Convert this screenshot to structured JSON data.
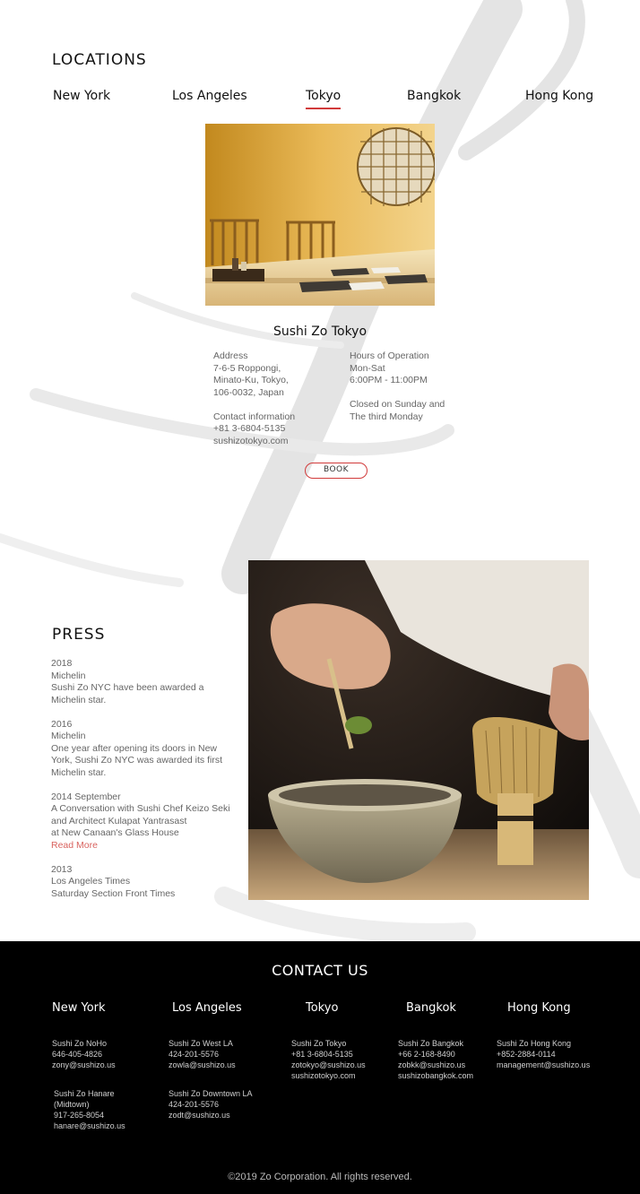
{
  "colors": {
    "accent": "#d13a3a",
    "link": "#d9635f",
    "footer_bg": "#000000"
  },
  "locations": {
    "title": "LOCATIONS",
    "tabs": [
      "New York",
      "Los Angeles",
      "Tokyo",
      "Bangkok",
      "Hong Kong"
    ],
    "active_tab": "Tokyo",
    "selected": {
      "name": "Sushi Zo Tokyo",
      "address_label": "Address",
      "address_lines": [
        "7-6-5 Roppongi,",
        "Minato-Ku, Tokyo,",
        "106-0032, Japan"
      ],
      "contact_label": "Contact information",
      "contact_lines": [
        "+81 3-6804-5135",
        "sushizotokyo.com"
      ],
      "hours_label": "Hours of Operation",
      "hours_lines": [
        "Mon-Sat",
        "6:00PM - 11:00PM"
      ],
      "closed_lines": [
        "Closed on Sunday and",
        "The third Monday"
      ],
      "book_label": "BOOK"
    }
  },
  "press": {
    "title": "PRESS",
    "entries": [
      {
        "lines": [
          "2018",
          "Michelin",
          "Sushi Zo NYC have been awarded a",
          "Michelin star."
        ]
      },
      {
        "lines": [
          "2016",
          "Michelin",
          "One year after opening its doors in New",
          "York, Sushi Zo NYC was awarded its first",
          "Michelin star."
        ]
      },
      {
        "lines": [
          "2014 September",
          "A Conversation with Sushi Chef Keizo Seki",
          "and Architect Kulapat Yantrasast",
          "at New Canaan's Glass House"
        ],
        "link": "Read More"
      },
      {
        "lines": [
          "2013",
          "Los Angeles Times",
          "Saturday Section Front Times"
        ]
      }
    ]
  },
  "footer": {
    "title": "CONTACT US",
    "cities": [
      "New York",
      "Los Angeles",
      "Tokyo",
      "Bangkok",
      "Hong Kong"
    ],
    "blocks": [
      [
        "Sushi Zo NoHo",
        "646-405-4826",
        "zony@sushizo.us"
      ],
      [
        "Sushi Zo Hanare",
        "(Midtown)",
        "917-265-8054",
        "hanare@sushizo.us"
      ],
      [
        "Sushi Zo West LA",
        "424-201-5576",
        "zowla@sushizo.us"
      ],
      [
        "Sushi Zo Downtown LA",
        "424-201-5576",
        "zodt@sushizo.us"
      ],
      [
        "Sushi Zo Tokyo",
        "+81 3-6804-5135",
        "zotokyo@sushizo.us",
        "sushizotokyo.com"
      ],
      [
        "Sushi Zo Bangkok",
        "+66 2-168-8490",
        "zobkk@sushizo.us",
        "sushizobangkok.com"
      ],
      [
        "Sushi Zo Hong Kong",
        "+852-2884-0114",
        "management@sushizo.us"
      ]
    ],
    "copyright": "©2019 Zo Corporation. All rights reserved."
  }
}
